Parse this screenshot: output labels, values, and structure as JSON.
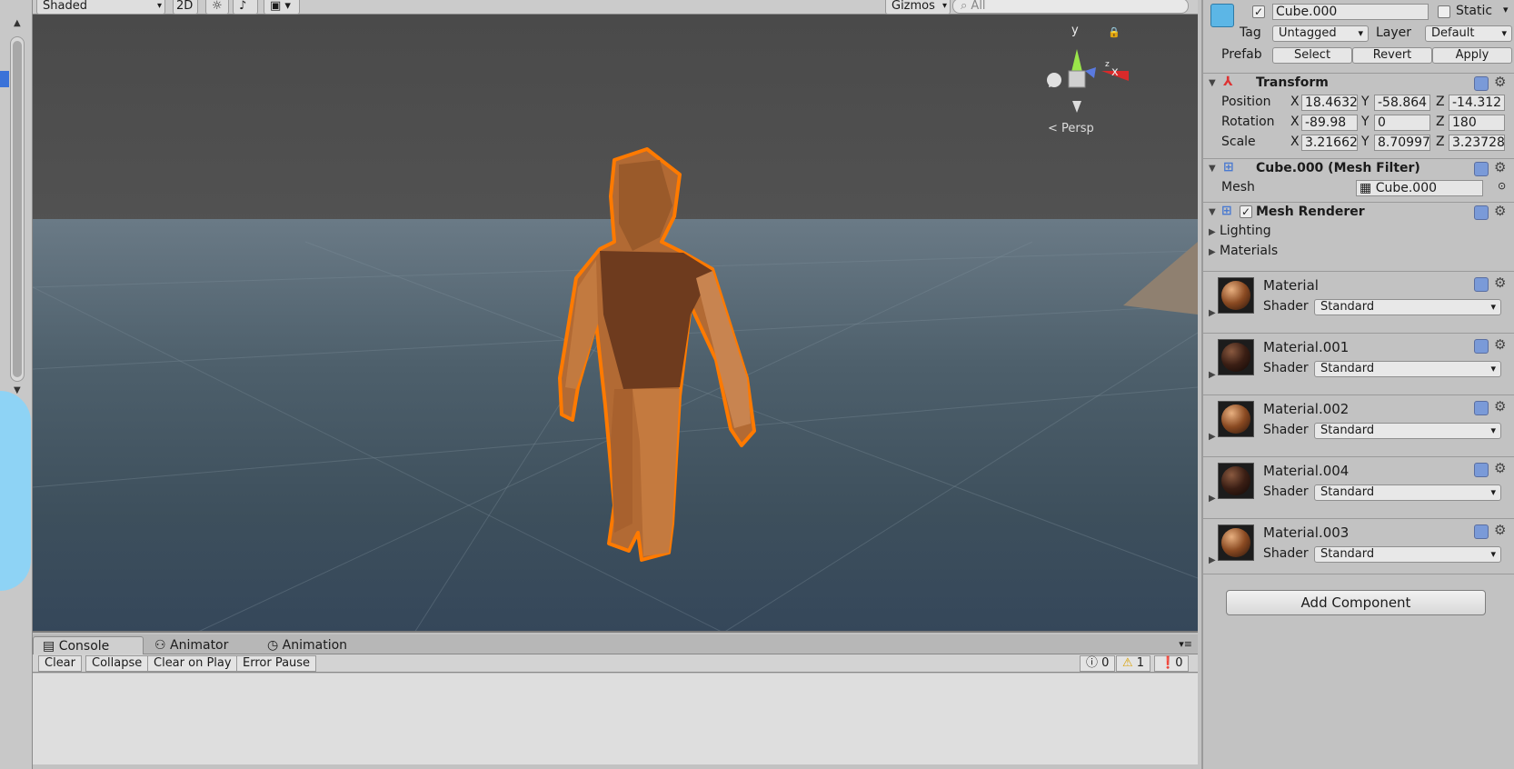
{
  "scene_toolbar": {
    "shading_mode": "Shaded",
    "mode_2d": "2D",
    "gizmos": "Gizmos",
    "search_placeholder": "All"
  },
  "scene": {
    "projection": "Persp",
    "axis_y": "y",
    "axis_x": "x",
    "axis_z": "z"
  },
  "console": {
    "tabs": [
      "Console",
      "Animator",
      "Animation"
    ],
    "buttons": [
      "Clear",
      "Collapse",
      "Clear on Play",
      "Error Pause"
    ],
    "counts": {
      "info": "0",
      "warning": "1",
      "error": "0"
    }
  },
  "inspector": {
    "object_name": "Cube.000",
    "static_label": "Static",
    "tag_label": "Tag",
    "tag_value": "Untagged",
    "layer_label": "Layer",
    "layer_value": "Default",
    "prefab_label": "Prefab",
    "prefab_buttons": [
      "Select",
      "Revert",
      "Apply"
    ],
    "transform": {
      "title": "Transform",
      "rows": [
        {
          "label": "Position",
          "x": "18.4632",
          "y": "-58.864",
          "z": "-14.312"
        },
        {
          "label": "Rotation",
          "x": "-89.98",
          "y": "0",
          "z": "180"
        },
        {
          "label": "Scale",
          "x": "3.21662",
          "y": "8.70997",
          "z": "3.23728"
        }
      ]
    },
    "mesh_filter": {
      "title": "Cube.000 (Mesh Filter)",
      "mesh_label": "Mesh",
      "mesh_value": "Cube.000"
    },
    "mesh_renderer": {
      "title": "Mesh Renderer",
      "lighting": "Lighting",
      "materials": "Materials"
    },
    "materials": [
      {
        "name": "Material",
        "shader_label": "Shader",
        "shader": "Standard",
        "color": "#8a4a22"
      },
      {
        "name": "Material.001",
        "shader_label": "Shader",
        "shader": "Standard",
        "color": "#3a1e14"
      },
      {
        "name": "Material.002",
        "shader_label": "Shader",
        "shader": "Standard",
        "color": "#8a4a22"
      },
      {
        "name": "Material.004",
        "shader_label": "Shader",
        "shader": "Standard",
        "color": "#3a1e14"
      },
      {
        "name": "Material.003",
        "shader_label": "Shader",
        "shader": "Standard",
        "color": "#8a4a22"
      }
    ],
    "add_component": "Add Component"
  },
  "colors": {
    "selection_outline": "#ff7a00",
    "accent": "#3a72d8"
  }
}
